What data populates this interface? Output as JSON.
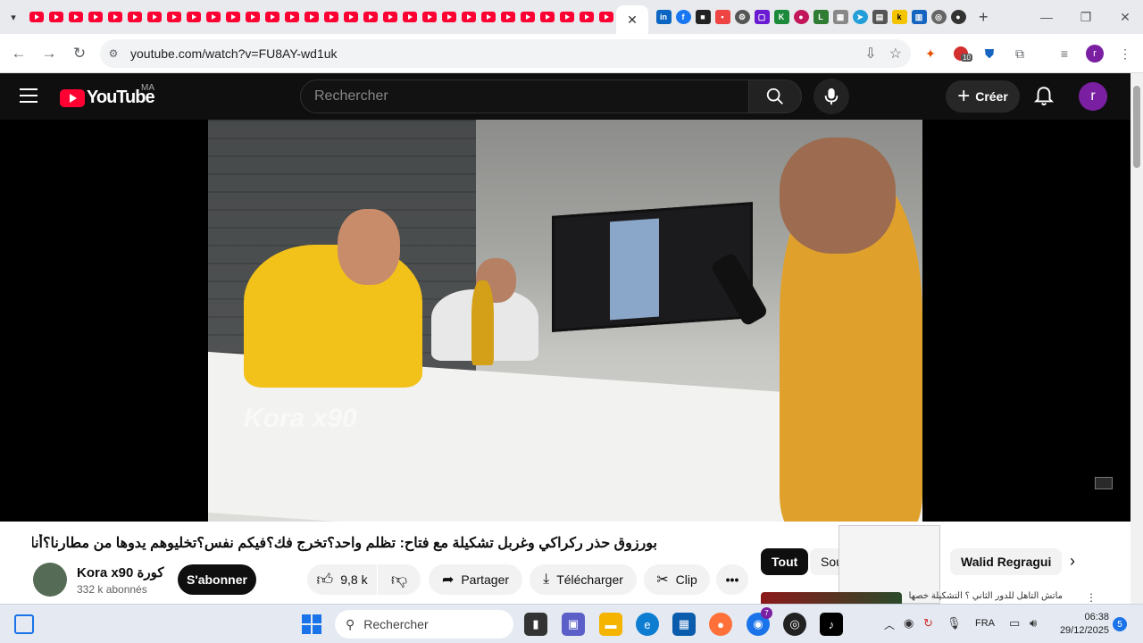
{
  "browser": {
    "url": "youtube.com/watch?v=FU8AY-wd1uk",
    "new_tab_symbol": "+",
    "close_tab_symbol": "✕"
  },
  "youtube": {
    "country_code": "MA",
    "logo_text": "YouTube",
    "search_placeholder": "Rechercher",
    "create_label": "Créer",
    "avatar_letter": "r"
  },
  "video": {
    "watermark": "Kora x90",
    "title": "بورزوق حذر ركراكي وغربل تشكيلة مع فتاح: تظلم واحد؟تخرج فك؟فيكم نفس؟تخليوهم يدوها من مطارنا؟أنا مرضت؟",
    "channel_name": "Kora x90 كورة",
    "subscribers": "332 k abonnés",
    "subscribe_label": "S'abonner",
    "likes": "9,8 k",
    "share_label": "Partager",
    "download_label": "Télécharger",
    "clip_label": "Clip"
  },
  "chips": {
    "all": "Tout",
    "partial": "Sou",
    "walid": "Walid Regragui"
  },
  "recommendation": {
    "title": "ماتش التأهل للدور الثاني ؟ التشكيلة خصها"
  },
  "taskbar": {
    "search_placeholder": "Rechercher",
    "language": "FRA",
    "time": "06:38",
    "date": "29/12/2025",
    "notification_count": "5",
    "extension_badge": "10",
    "chrome_badge": "7"
  },
  "colors": {
    "youtube_red": "#ff0033",
    "avatar_purple": "#7b1fa2"
  }
}
